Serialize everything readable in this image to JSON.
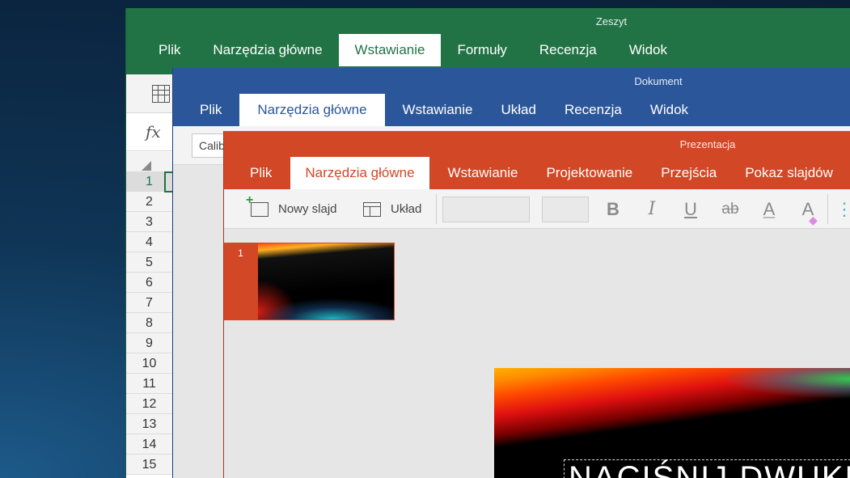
{
  "excel": {
    "title": "Zeszyt",
    "tabs": [
      "Plik",
      "Narzędzia główne",
      "Wstawianie",
      "Formuły",
      "Recenzja",
      "Widok"
    ],
    "active_tab": "Wstawianie",
    "formula_icon": "fx",
    "rows": [
      "1",
      "2",
      "3",
      "4",
      "5",
      "6",
      "7",
      "8",
      "9",
      "10",
      "11",
      "12",
      "13",
      "14",
      "15"
    ]
  },
  "word": {
    "title": "Dokument",
    "tabs": [
      "Plik",
      "Narzędzia główne",
      "Wstawianie",
      "Układ",
      "Recenzja",
      "Widok"
    ],
    "active_tab": "Narzędzia główne",
    "font_name": "Calibri"
  },
  "ppt": {
    "title": "Prezentacja",
    "tabs": [
      "Plik",
      "Narzędzia główne",
      "Wstawianie",
      "Projektowanie",
      "Przejścia",
      "Pokaz slajdów"
    ],
    "active_tab": "Narzędzia główne",
    "toolbar": {
      "new_slide": "Nowy slajd",
      "layout": "Układ",
      "bold": "B",
      "italic": "I",
      "underline": "U",
      "strikethrough": "ab",
      "font_color": "A",
      "highlight": "A"
    },
    "thumb_number": "1",
    "slide_title": "NACIŚNIJ DWUKROTNIE"
  },
  "colors": {
    "excel_green": "#217346",
    "word_blue": "#2b579a",
    "ppt_orange": "#d24726"
  }
}
